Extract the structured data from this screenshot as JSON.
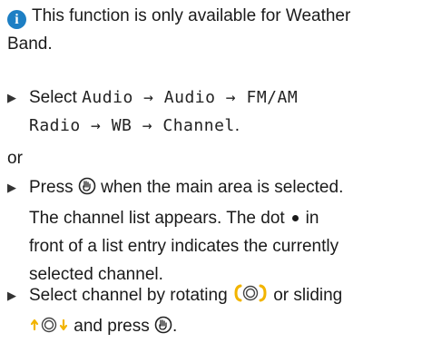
{
  "note": {
    "icon": "info-icon",
    "icon_glyph": "i",
    "text_line1": "This function is only available for Weather",
    "text_line2": "Band."
  },
  "step1": {
    "bullet": "▶",
    "prefix": "Select",
    "path_line1": "Audio → Audio → FM/AM",
    "path_line2": "Radio → WB → Channel",
    "suffix": "."
  },
  "or_label": "or",
  "step2": {
    "bullet": "▶",
    "press": "Press",
    "after_press": "when the main area is selected.",
    "line2": "The channel list appears. The dot",
    "after_dot": "in",
    "line3": "front of a list entry indicates the currently",
    "line4": "selected channel."
  },
  "step3": {
    "bullet": "▶",
    "text1": "Select channel by rotating",
    "text2": "or sliding",
    "text3": "and press",
    "end": "."
  },
  "colors": {
    "info_icon": "#1d7fc4",
    "controller_accent": "#f2b400"
  }
}
